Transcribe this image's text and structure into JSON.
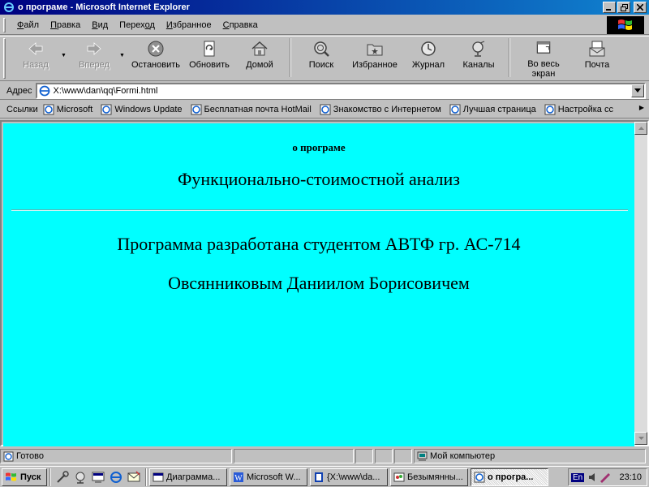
{
  "window": {
    "title": "о програме - Microsoft Internet Explorer"
  },
  "menu": {
    "items": [
      {
        "u": "Ф",
        "rest": "айл"
      },
      {
        "u": "П",
        "rest": "равка"
      },
      {
        "u": "В",
        "rest": "ид"
      },
      {
        "pre": "Перех",
        "u": "о",
        "rest": "д"
      },
      {
        "u": "И",
        "rest": "збранное"
      },
      {
        "u": "С",
        "rest": "правка"
      }
    ]
  },
  "toolbar": {
    "back": "Назад",
    "forward": "Вперед",
    "stop": "Остановить",
    "refresh": "Обновить",
    "home": "Домой",
    "search": "Поиск",
    "favorites": "Избранное",
    "history": "Журнал",
    "channels": "Каналы",
    "fullscreen_1": "Во весь",
    "fullscreen_2": "экран",
    "mail": "Почта"
  },
  "address": {
    "label": "Адрес",
    "value": "X:\\www\\dan\\qq\\Formi.html"
  },
  "links": {
    "label": "Ссылки",
    "items": [
      "Microsoft",
      "Windows Update",
      "Бесплатная почта HotMail",
      "Знакомство с Интернетом",
      "Лучшая страница",
      "Настройка сс"
    ]
  },
  "page": {
    "heading": "о програме",
    "subtitle": "Функционально-стоимостной анализ",
    "line1": "Программа разработана студентом АВТФ гр. АС-714",
    "line2": "Овсянниковым Даниилом Борисовичем"
  },
  "status": {
    "text": "Готово",
    "zone": "Мой компьютер"
  },
  "taskbar": {
    "start": "Пуск",
    "tasks": [
      "Диаграмма...",
      "Microsoft W...",
      "{X:\\www\\da...",
      "Безымянны...",
      "о програ..."
    ],
    "lang": "En",
    "clock": "23:10"
  },
  "colors": {
    "page_background": "#00ffff",
    "titlebar_start": "#000080",
    "titlebar_end": "#1084d0",
    "chrome": "#c0c0c0"
  }
}
